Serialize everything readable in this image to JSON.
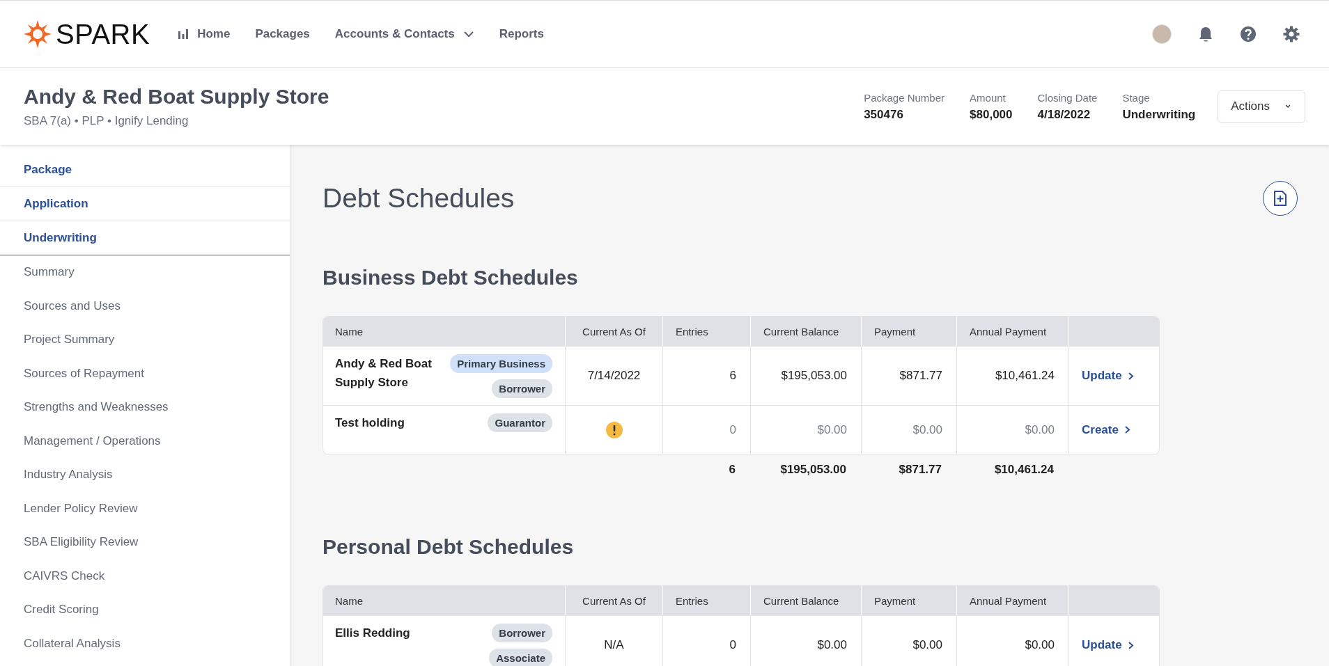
{
  "brand": {
    "name": "SPARK"
  },
  "nav": [
    {
      "label": "Home",
      "kind": "chart"
    },
    {
      "label": "Packages",
      "kind": "link"
    },
    {
      "label": "Accounts & Contacts",
      "kind": "dropdown"
    },
    {
      "label": "Reports",
      "kind": "link"
    }
  ],
  "package": {
    "title": "Andy & Red Boat Supply Store",
    "subtitle": "SBA 7(a) • PLP • Ignify Lending",
    "meta": [
      {
        "label": "Package Number",
        "value": "350476"
      },
      {
        "label": "Amount",
        "value": "$80,000"
      },
      {
        "label": "Closing Date",
        "value": "4/18/2022"
      },
      {
        "label": "Stage",
        "value": "Underwriting"
      }
    ],
    "actions_button": "Actions"
  },
  "sidebar": {
    "sections": [
      {
        "label": "Package",
        "expanded": false
      },
      {
        "label": "Application",
        "expanded": false
      },
      {
        "label": "Underwriting",
        "expanded": true,
        "children": [
          {
            "label": "Summary"
          },
          {
            "label": "Sources and Uses"
          },
          {
            "label": "Project Summary"
          },
          {
            "label": "Sources of Repayment"
          },
          {
            "label": "Strengths and Weaknesses"
          },
          {
            "label": "Management / Operations"
          },
          {
            "label": "Industry Analysis"
          },
          {
            "label": "Lender Policy Review"
          },
          {
            "label": "SBA Eligibility Review"
          },
          {
            "label": "CAIVRS Check"
          },
          {
            "label": "Credit Scoring"
          },
          {
            "label": "Collateral Analysis"
          }
        ]
      }
    ]
  },
  "page_title": "Debt Schedules",
  "schedules": [
    {
      "title": "Business Debt Schedules",
      "columns": [
        "Name",
        "Current As Of",
        "Entries",
        "Current Balance",
        "Payment",
        "Annual Payment"
      ],
      "rows": [
        {
          "name": "Andy & Red Boat Supply Store",
          "tags": [
            {
              "label": "Primary Business",
              "color": "#cfe0f8"
            },
            {
              "label": "Borrower",
              "color": "#dde2e9"
            }
          ],
          "current_as_of": "7/14/2022",
          "warning": false,
          "muted": false,
          "entries": "6",
          "current_balance": "$195,053.00",
          "payment": "$871.77",
          "annual_payment": "$10,461.24",
          "action": "Update"
        },
        {
          "name": "Test holding",
          "tags": [
            {
              "label": "Guarantor",
              "color": "#dde2e9"
            }
          ],
          "current_as_of": "",
          "warning": true,
          "muted": true,
          "entries": "0",
          "current_balance": "$0.00",
          "payment": "$0.00",
          "annual_payment": "$0.00",
          "action": "Create"
        }
      ],
      "totals": {
        "entries": "6",
        "current_balance": "$195,053.00",
        "payment": "$871.77",
        "annual_payment": "$10,461.24"
      }
    },
    {
      "title": "Personal Debt Schedules",
      "columns": [
        "Name",
        "Current As Of",
        "Entries",
        "Current Balance",
        "Payment",
        "Annual Payment"
      ],
      "rows": [
        {
          "name": "Ellis Redding",
          "tags": [
            {
              "label": "Borrower",
              "color": "#dde2e9"
            },
            {
              "label": "Associate",
              "color": "#dde2e9"
            }
          ],
          "current_as_of": "N/A",
          "warning": false,
          "muted": false,
          "entries": "0",
          "current_balance": "$0.00",
          "payment": "$0.00",
          "annual_payment": "$0.00",
          "action": "Update"
        }
      ]
    }
  ]
}
